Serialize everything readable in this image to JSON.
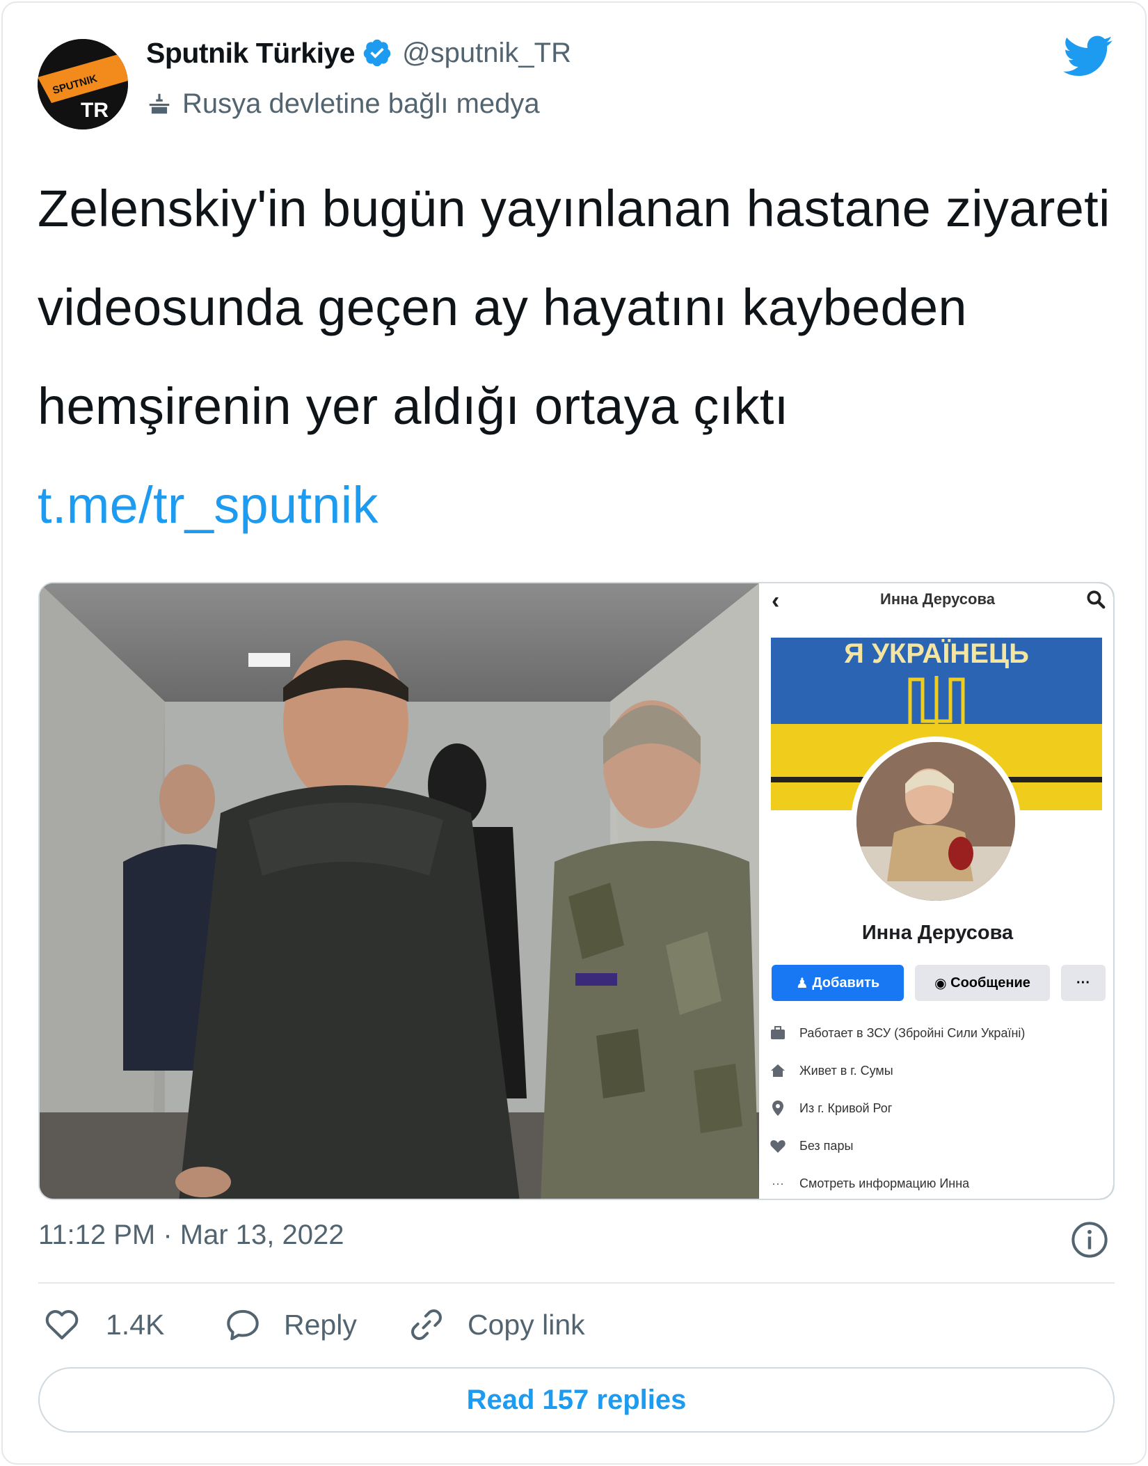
{
  "author": {
    "name": "Sputnik Türkiye",
    "handle": "@sputnik_TR",
    "affiliation": "Rusya devletine bağlı medya",
    "avatar_text": "TR",
    "avatar_brand": "SPUTNIK",
    "verified_color": "#1d9bf0"
  },
  "tweet": {
    "text": "Zelenskiy'in bugün yayınlanan hastane ziyareti videosunda geçen ay hayatını kaybeden hemşirenin yer aldığı ortaya çıktı ",
    "link": "t.me/tr_sputnik"
  },
  "media": {
    "facebook_profile": {
      "header_name": "Инна Дерусова",
      "cover_text": "Я УКРАЇНЕЦЬ",
      "profile_name": "Инна Дерусова",
      "add_button": "Добавить",
      "message_button": "Сообщение",
      "more_button": "···",
      "info": [
        {
          "icon": "briefcase-icon",
          "text": "Работает в ЗСУ (Збройні Сили Україні)"
        },
        {
          "icon": "home-icon",
          "text": "Живет в г. Сумы"
        },
        {
          "icon": "location-pin-icon",
          "text": "Из г. Кривой Рог"
        },
        {
          "icon": "heart-icon",
          "text": "Без пары"
        },
        {
          "icon": "ellipsis-icon",
          "text": "Смотреть информацию Инна"
        }
      ]
    }
  },
  "meta": {
    "timestamp": "11:12 PM · Mar 13, 2022"
  },
  "actions": {
    "likes": "1.4K",
    "reply": "Reply",
    "copy_link": "Copy link",
    "read_replies": "Read 157 replies"
  },
  "colors": {
    "accent": "#1d9bf0",
    "text_secondary": "#536471",
    "border": "#cfd9de"
  }
}
